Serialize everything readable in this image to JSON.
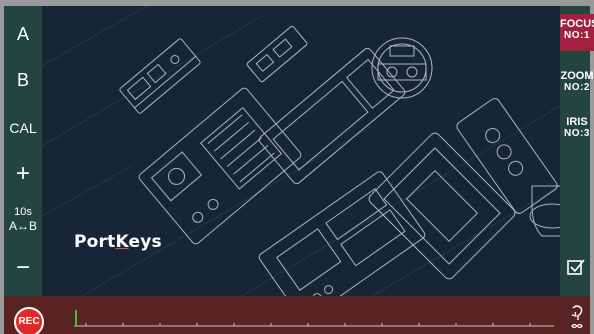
{
  "left_toolbar": {
    "a_label": "A",
    "b_label": "B",
    "cal_label": "CAL",
    "plus_label": "+",
    "time_label": "10s",
    "ab_label": "A↔B",
    "minus_label": "−"
  },
  "viewport": {
    "logo_part1": "Port",
    "logo_part2": "K",
    "logo_part3": "eys"
  },
  "right_panel": {
    "focus": {
      "title": "FOCUS",
      "sub": "NO:1"
    },
    "zoom": {
      "title": "ZOOM",
      "sub": "NO:2"
    },
    "iris": {
      "title": "IRIS",
      "sub": "NO:3"
    },
    "check_icon": "checkbox-icon"
  },
  "bottom_bar": {
    "rec_label": "REC",
    "loop_icon": "loop-icon"
  },
  "colors": {
    "panel": "#24453f",
    "viewport": "#162637",
    "active": "#a1213e",
    "bottom": "#5a2323",
    "rec": "#e02a2a",
    "cursor": "#3fbf3f"
  }
}
